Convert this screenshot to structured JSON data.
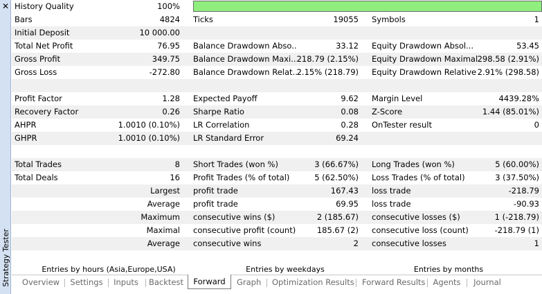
{
  "panel_title": "Strategy Tester",
  "close_glyph": "✕",
  "history_quality": {
    "label": "History Quality",
    "value": "100%",
    "fraction": 1.0,
    "bar_color": "#90ee7e"
  },
  "rows": [
    {
      "shade": false,
      "cells": [
        {
          "text": "Bars"
        },
        {
          "text": "4824",
          "r": true
        },
        {
          "text": "Ticks"
        },
        {
          "text": "19055",
          "r": true
        },
        {
          "text": "Symbols"
        },
        {
          "text": "1",
          "r": true
        }
      ]
    },
    {
      "shade": true,
      "cells": [
        {
          "text": "Initial Deposit"
        },
        {
          "text": "10 000.00",
          "r": true
        },
        {
          "text": ""
        },
        {
          "text": "",
          "r": true
        },
        {
          "text": ""
        },
        {
          "text": "",
          "r": true
        }
      ]
    },
    {
      "shade": false,
      "cells": [
        {
          "text": "Total Net Profit"
        },
        {
          "text": "76.95",
          "r": true
        },
        {
          "text": "Balance Drawdown Abso..."
        },
        {
          "text": "33.12",
          "r": true
        },
        {
          "text": "Equity Drawdown Absol..."
        },
        {
          "text": "53.45",
          "r": true
        }
      ]
    },
    {
      "shade": true,
      "cells": [
        {
          "text": "Gross Profit"
        },
        {
          "text": "349.75",
          "r": true
        },
        {
          "text": "Balance Drawdown Maxi..."
        },
        {
          "text": "218.79 (2.15%)",
          "r": true
        },
        {
          "text": "Equity Drawdown Maximal"
        },
        {
          "text": "298.58 (2.91%)",
          "r": true
        }
      ]
    },
    {
      "shade": false,
      "cells": [
        {
          "text": "Gross Loss"
        },
        {
          "text": "-272.80",
          "r": true
        },
        {
          "text": "Balance Drawdown Relat..."
        },
        {
          "text": "2.15% (218.79)",
          "r": true
        },
        {
          "text": "Equity Drawdown Relative"
        },
        {
          "text": "2.91% (298.58)",
          "r": true
        }
      ]
    },
    {
      "shade": true,
      "cells": []
    },
    {
      "shade": false,
      "cells": [
        {
          "text": "Profit Factor"
        },
        {
          "text": "1.28",
          "r": true
        },
        {
          "text": "Expected Payoff"
        },
        {
          "text": "9.62",
          "r": true
        },
        {
          "text": "Margin Level"
        },
        {
          "text": "4439.28%",
          "r": true
        }
      ]
    },
    {
      "shade": true,
      "cells": [
        {
          "text": "Recovery Factor"
        },
        {
          "text": "0.26",
          "r": true
        },
        {
          "text": "Sharpe Ratio"
        },
        {
          "text": "0.08",
          "r": true
        },
        {
          "text": "Z-Score"
        },
        {
          "text": "1.44 (85.01%)",
          "r": true
        }
      ]
    },
    {
      "shade": false,
      "cells": [
        {
          "text": "AHPR"
        },
        {
          "text": "1.0010 (0.10%)",
          "r": true
        },
        {
          "text": "LR Correlation"
        },
        {
          "text": "0.28",
          "r": true
        },
        {
          "text": "OnTester result"
        },
        {
          "text": "0",
          "r": true
        }
      ]
    },
    {
      "shade": true,
      "cells": [
        {
          "text": "GHPR"
        },
        {
          "text": "1.0010 (0.10%)",
          "r": true
        },
        {
          "text": "LR Standard Error"
        },
        {
          "text": "69.24",
          "r": true
        },
        {
          "text": ""
        },
        {
          "text": "",
          "r": true
        }
      ]
    },
    {
      "shade": false,
      "cells": []
    },
    {
      "shade": true,
      "cells": [
        {
          "text": "Total Trades"
        },
        {
          "text": "8",
          "r": true
        },
        {
          "text": "Short Trades (won %)"
        },
        {
          "text": "3 (66.67%)",
          "r": true
        },
        {
          "text": "Long Trades (won %)"
        },
        {
          "text": "5 (60.00%)",
          "r": true
        }
      ]
    },
    {
      "shade": false,
      "cells": [
        {
          "text": "Total Deals"
        },
        {
          "text": "16",
          "r": true
        },
        {
          "text": "Profit Trades (% of total)"
        },
        {
          "text": "5 (62.50%)",
          "r": true
        },
        {
          "text": "Loss Trades (% of total)"
        },
        {
          "text": "3 (37.50%)",
          "r": true
        }
      ]
    },
    {
      "shade": true,
      "cells": [
        {
          "text": ""
        },
        {
          "text": "Largest",
          "r": true
        },
        {
          "text": "profit trade"
        },
        {
          "text": "167.43",
          "r": true
        },
        {
          "text": "loss trade"
        },
        {
          "text": "-218.79",
          "r": true
        }
      ]
    },
    {
      "shade": false,
      "cells": [
        {
          "text": ""
        },
        {
          "text": "Average",
          "r": true
        },
        {
          "text": "profit trade"
        },
        {
          "text": "69.95",
          "r": true
        },
        {
          "text": "loss trade"
        },
        {
          "text": "-90.93",
          "r": true
        }
      ]
    },
    {
      "shade": true,
      "cells": [
        {
          "text": ""
        },
        {
          "text": "Maximum",
          "r": true
        },
        {
          "text": "consecutive wins ($)"
        },
        {
          "text": "2 (185.67)",
          "r": true
        },
        {
          "text": "consecutive losses ($)"
        },
        {
          "text": "1 (-218.79)",
          "r": true
        }
      ]
    },
    {
      "shade": false,
      "cells": [
        {
          "text": ""
        },
        {
          "text": "Maximal",
          "r": true
        },
        {
          "text": "consecutive profit (count)"
        },
        {
          "text": "185.67 (2)",
          "r": true
        },
        {
          "text": "consecutive loss (count)"
        },
        {
          "text": "-218.79 (1)",
          "r": true
        }
      ]
    },
    {
      "shade": true,
      "cells": [
        {
          "text": ""
        },
        {
          "text": "Average",
          "r": true
        },
        {
          "text": "consecutive wins"
        },
        {
          "text": "2",
          "r": true
        },
        {
          "text": "consecutive losses"
        },
        {
          "text": "1",
          "r": true
        }
      ]
    }
  ],
  "sub_tabs": [
    "Entries by hours (Asia,Europe,USA)",
    "Entries by weekdays",
    "Entries by months"
  ],
  "tabs": [
    {
      "label": "Overview"
    },
    {
      "label": "Settings"
    },
    {
      "label": "Inputs"
    },
    {
      "label": "Backtest"
    },
    {
      "label": "Forward",
      "active": true
    },
    {
      "label": "Graph"
    },
    {
      "label": "Optimization Results"
    },
    {
      "label": "Forward Results"
    },
    {
      "label": "Agents"
    },
    {
      "label": "Journal"
    }
  ]
}
